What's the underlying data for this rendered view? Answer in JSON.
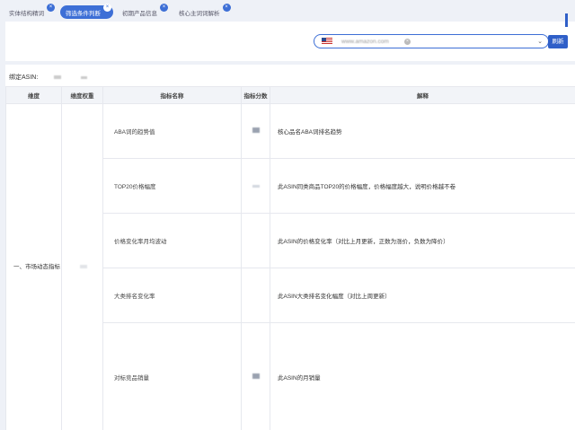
{
  "tabs": [
    {
      "label": "实体结构精词",
      "active": false
    },
    {
      "label": "筛选条件判断",
      "active": true
    },
    {
      "label": "初期产品信息",
      "active": false
    },
    {
      "label": "核心主词词解析",
      "active": false
    }
  ],
  "toolbar": {
    "site_value": "www.amazon.com",
    "refresh_label": "刷新"
  },
  "asin": {
    "label": "绑定ASIN:"
  },
  "table": {
    "headers": [
      "维度",
      "维度权重",
      "指标名称",
      "指标分数",
      "解释"
    ],
    "dimension": "一、市场动态指标",
    "rows": [
      {
        "name": "ABA词的趋势值",
        "desc": "核心品名ABA词排名趋势"
      },
      {
        "name": "TOP20价格幅度",
        "desc": "此ASIN同类商品TOP20的价格幅度，价格幅度越大，说明价格越不卷"
      },
      {
        "name": "价格变化率月均波动",
        "desc": "此ASIN的价格变化率（对比上月更新，正数为涨价，负数为降价）"
      },
      {
        "name": "大类排名变化率",
        "desc": "此ASIN大类排名变化幅度（对比上周更新）"
      },
      {
        "name": "对标竞品销量",
        "desc": "此ASIN的月销量"
      }
    ]
  }
}
